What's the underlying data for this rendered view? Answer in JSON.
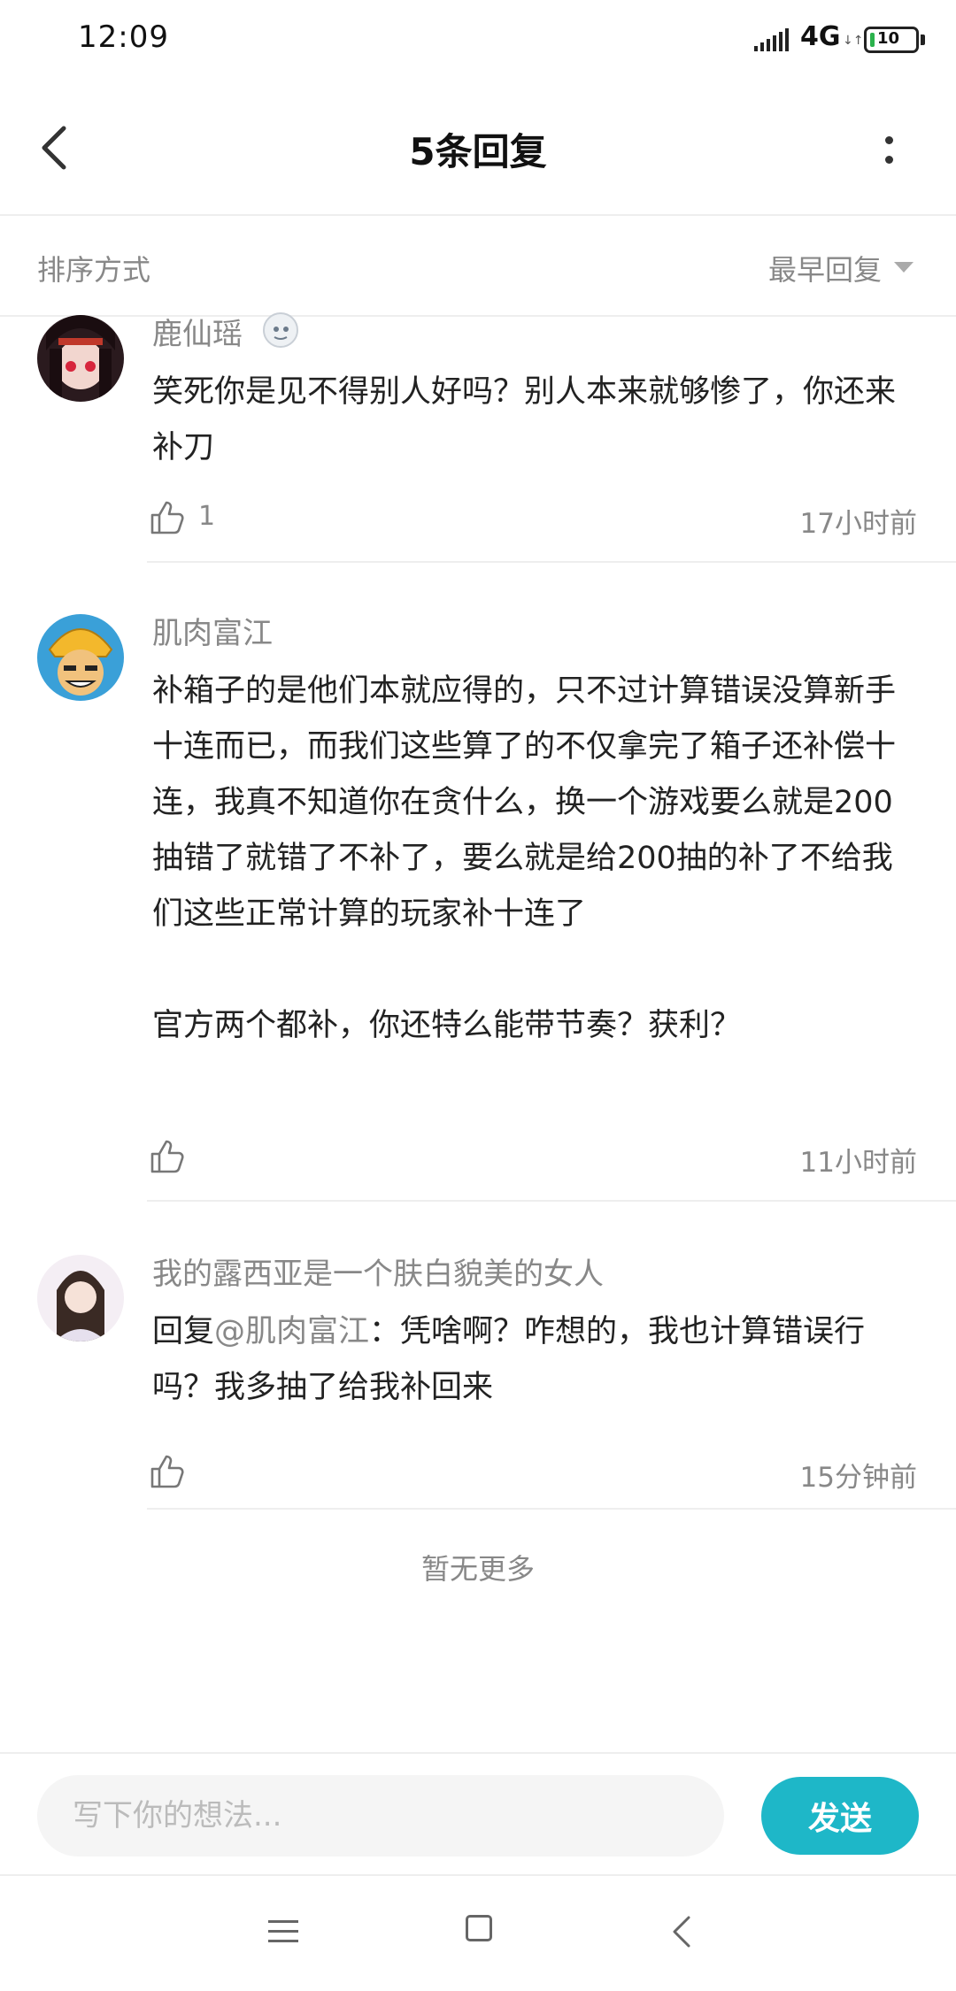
{
  "status_bar": {
    "time": "12:09",
    "network": "4G",
    "battery": "10",
    "battery_level_percent": 10
  },
  "header": {
    "title": "5条回复",
    "icons": [
      "back-icon",
      "more-icon"
    ]
  },
  "sort_bar": {
    "label": "排序方式",
    "value": "最早回复"
  },
  "comments": [
    {
      "username": "鹿仙瑶",
      "content": "笑死你是见不得别人好吗？别人本来就够惨了，你还来补刀",
      "likes": "1",
      "time": "17小时前"
    },
    {
      "username": "肌肉富江",
      "content": "补箱子的是他们本就应得的，只不过计算错误没算新手十连而已，而我们这些算了的不仅拿完了箱子还补偿十连，我真不知道你在贪什么，换一个游戏要么就是200抽错了就错了不补了，要么就是给200抽的补了不给我们这些正常计算的玩家补十连了\n\n官方两个都补，你还特么能带节奏？获利？",
      "likes": "",
      "time": "11小时前"
    },
    {
      "username": "我的露西亚是一个肤白貌美的女人",
      "reply_prefix": "回复",
      "mention": "@肌肉富江",
      "content": "：凭啥啊？咋想的，我也计算错误行吗？我多抽了给我补回来",
      "likes": "",
      "time": "15分钟前"
    }
  ],
  "footer_text": "暂无更多",
  "input_bar": {
    "placeholder": "写下你的想法...",
    "value": "",
    "send_label": "发送"
  },
  "colors": {
    "accent": "#1eb7c8",
    "secondary_text": "#888888",
    "primary_text": "#222222"
  }
}
